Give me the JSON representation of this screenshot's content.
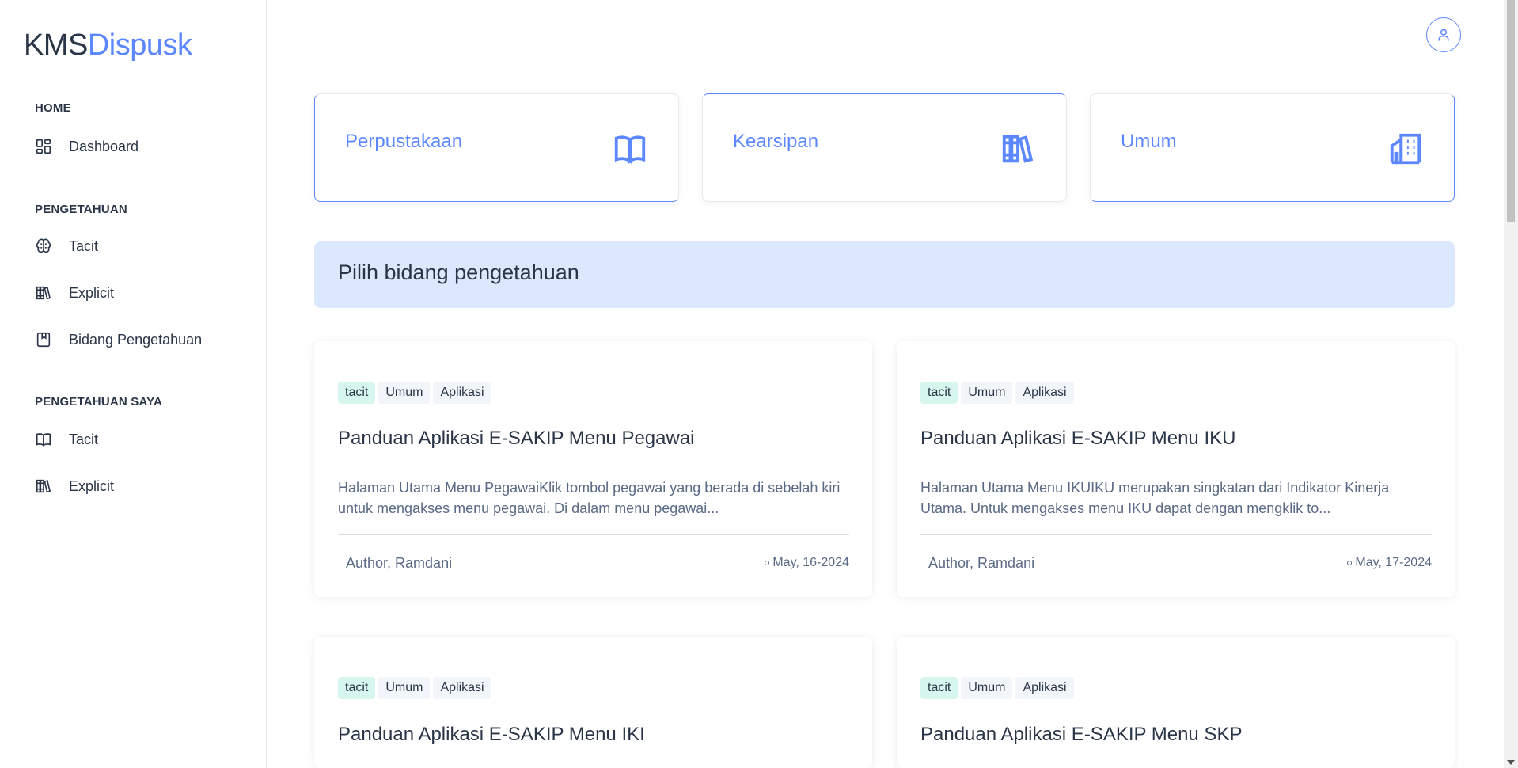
{
  "brand": {
    "part1": "KMS",
    "part2": "Dispusk"
  },
  "sidebar": {
    "sections": [
      {
        "title": "HOME",
        "items": [
          {
            "label": "Dashboard",
            "icon": "dashboard-icon"
          }
        ]
      },
      {
        "title": "PENGETAHUAN",
        "items": [
          {
            "label": "Tacit",
            "icon": "brain-icon"
          },
          {
            "label": "Explicit",
            "icon": "books-icon"
          },
          {
            "label": "Bidang Pengetahuan",
            "icon": "bookmark-icon"
          }
        ]
      },
      {
        "title": "PENGETAHUAN SAYA",
        "items": [
          {
            "label": "Tacit",
            "icon": "book-open-icon"
          },
          {
            "label": "Explicit",
            "icon": "books-icon"
          }
        ]
      }
    ]
  },
  "categories": [
    {
      "label": "Perpustakaan",
      "icon": "book-open-icon"
    },
    {
      "label": "Kearsipan",
      "icon": "books-icon"
    },
    {
      "label": "Umum",
      "icon": "building-icon"
    }
  ],
  "banner": {
    "title": "Pilih bidang pengetahuan"
  },
  "posts": [
    {
      "tags": [
        "tacit",
        "Umum",
        "Aplikasi"
      ],
      "title": "Panduan Aplikasi E-SAKIP Menu Pegawai",
      "excerpt": "Halaman Utama Menu PegawaiKlik tombol pegawai yang berada di sebelah kiri untuk mengakses menu pegawai. Di dalam menu pegawai...",
      "author": "Author, Ramdani",
      "date": "May, 16-2024"
    },
    {
      "tags": [
        "tacit",
        "Umum",
        "Aplikasi"
      ],
      "title": "Panduan Aplikasi E-SAKIP Menu IKU",
      "excerpt": "Halaman Utama Menu IKUIKU merupakan singkatan dari Indikator Kinerja Utama. Untuk mengakses menu IKU dapat dengan mengklik to...",
      "author": "Author, Ramdani",
      "date": "May, 17-2024"
    },
    {
      "tags": [
        "tacit",
        "Umum",
        "Aplikasi"
      ],
      "title": "Panduan Aplikasi E-SAKIP Menu IKI",
      "excerpt": "",
      "author": "",
      "date": ""
    },
    {
      "tags": [
        "tacit",
        "Umum",
        "Aplikasi"
      ],
      "title": "Panduan Aplikasi E-SAKIP Menu SKP",
      "excerpt": "",
      "author": "",
      "date": ""
    }
  ],
  "colors": {
    "primary": "#5d87ff",
    "banner_bg": "#dce8fd",
    "tag_tacit_bg": "#d7f6ee",
    "text": "#2a3547",
    "muted": "#5a6a85"
  }
}
